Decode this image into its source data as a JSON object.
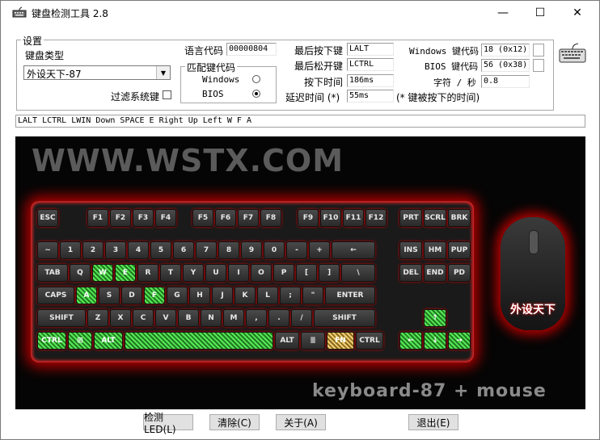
{
  "window": {
    "title": "键盘检测工具 2.8",
    "minimize": "—",
    "maximize": "☐",
    "close": "✕"
  },
  "settings": {
    "group_label": "设置",
    "keyboard_type_label": "键盘类型",
    "keyboard_type_value": "外设天下-87",
    "filter_label": "过滤系统键",
    "filter_checked": false,
    "language_code_label": "语言代码",
    "language_code_value": "00000804",
    "match_group_label": "匹配键代码",
    "match_windows_label": "Windows",
    "match_bios_label": "BIOS",
    "match_selected": "BIOS"
  },
  "stats": {
    "last_pressed_label": "最后按下键",
    "last_pressed_value": "LALT",
    "last_released_label": "最后松开键",
    "last_released_value": "LCTRL",
    "press_time_label": "按下时间",
    "press_time_value": "186ms",
    "delay_label": "延迟时间 (*)",
    "delay_value": "55ms",
    "delay_note": "(* 键被按下的时间)",
    "win_code_label": "Windows 键代码",
    "win_code_value": "18 (0x12)",
    "bios_code_label": "BIOS 键代码",
    "bios_code_value": "56 (0x38)",
    "cps_label": "字符 / 秒",
    "cps_value": "0.8"
  },
  "log_text": "LALT LCTRL LWIN Down SPACE E Right Up Left W F A",
  "image": {
    "site": "WWW.WSTX.COM",
    "model": "keyboard-87 + mouse",
    "mouse_logo": "外设天下"
  },
  "keys": {
    "row0": [
      "ESC",
      "F1",
      "F2",
      "F3",
      "F4",
      "F5",
      "F6",
      "F7",
      "F8",
      "F9",
      "F10",
      "F11",
      "F12",
      "PRT",
      "SCRL",
      "BRK"
    ],
    "row1": [
      "~",
      "1",
      "2",
      "3",
      "4",
      "5",
      "6",
      "7",
      "8",
      "9",
      "0",
      "-",
      "+",
      "←",
      "INS",
      "HM",
      "PUP"
    ],
    "row2": [
      "TAB",
      "Q",
      "W",
      "E",
      "R",
      "T",
      "Y",
      "U",
      "I",
      "O",
      "P",
      "[",
      "]",
      "\\",
      "DEL",
      "END",
      "PD"
    ],
    "row3": [
      "CAPS",
      "A",
      "S",
      "D",
      "F",
      "G",
      "H",
      "J",
      "K",
      "L",
      ";",
      "\"",
      "ENTER"
    ],
    "row4": [
      "SHIFT",
      "Z",
      "X",
      "C",
      "V",
      "B",
      "N",
      "M",
      ",",
      ".",
      "/",
      "SHIFT",
      "↑"
    ],
    "row5": [
      "CTRL",
      "⊞",
      "ALT",
      "",
      "ALT",
      "≣",
      "FN",
      "CTRL",
      "←",
      "↓",
      "→"
    ]
  },
  "buttons": {
    "led": "检测LED(L)",
    "clear": "清除(C)",
    "about": "关于(A)",
    "exit": "退出(E)"
  },
  "colors": {
    "highlight": "#3ad43a",
    "glow": "#b30000"
  }
}
